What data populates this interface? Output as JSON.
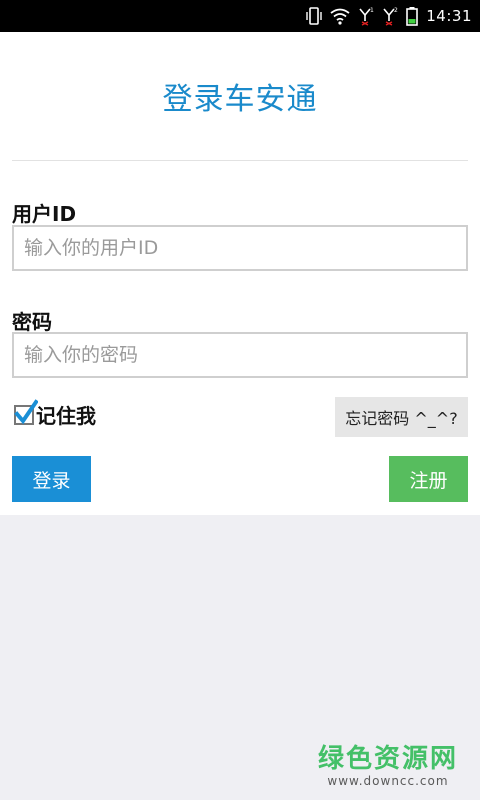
{
  "status_bar": {
    "time": "14:31",
    "icons": [
      "vibrate-icon",
      "wifi-icon",
      "signal-1-icon",
      "signal-2-icon",
      "battery-icon"
    ],
    "signal_1_label": "1",
    "signal_2_label": "2"
  },
  "login": {
    "title": "登录车安通",
    "user_label": "用户ID",
    "user_placeholder": "输入你的用户ID",
    "user_value": "",
    "password_label": "密码",
    "password_placeholder": "输入你的密码",
    "password_value": "",
    "remember_label": "记住我",
    "remember_checked": true,
    "forgot_label": "忘记密码 ^_^?",
    "login_label": "登录",
    "register_label": "注册"
  },
  "watermark": {
    "main": "绿色资源网",
    "sub": "www.downcc.com"
  },
  "colors": {
    "accent_blue": "#1a8fd6",
    "title_blue": "#1a8acb",
    "register_green": "#57bd5e",
    "watermark_green": "#44c068",
    "background": "#efeff3"
  }
}
